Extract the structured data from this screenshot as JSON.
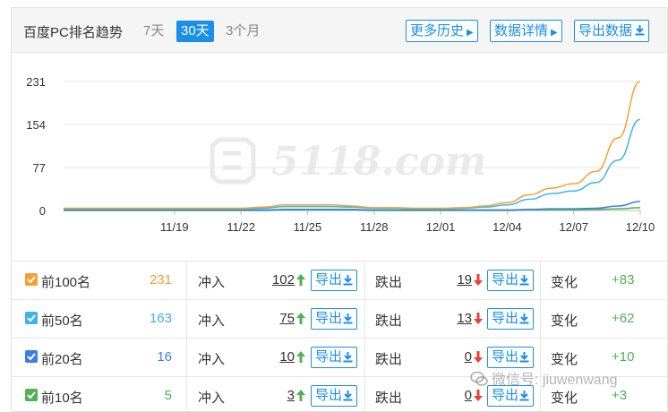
{
  "header": {
    "title": "百度PC排名趋势",
    "tabs": [
      {
        "label": "7天",
        "active": false
      },
      {
        "label": "30天",
        "active": true
      },
      {
        "label": "3个月",
        "active": false
      }
    ],
    "buttons": {
      "history": "更多历史",
      "details": "数据详情",
      "export": "导出数据"
    },
    "accent": "#1a8fe8"
  },
  "chart_data": {
    "type": "line",
    "watermark": "5118.com",
    "y_ticks": [
      "231",
      "154",
      "77",
      "0"
    ],
    "ylim": [
      0,
      231
    ],
    "x_ticks": [
      "11/19",
      "11/22",
      "11/25",
      "11/28",
      "12/01",
      "12/04",
      "12/07",
      "12/10"
    ],
    "x": [
      "11/14",
      "11/15",
      "11/16",
      "11/17",
      "11/18",
      "11/19",
      "11/20",
      "11/21",
      "11/22",
      "11/23",
      "11/24",
      "11/25",
      "11/26",
      "11/27",
      "11/28",
      "11/29",
      "11/30",
      "12/01",
      "12/02",
      "12/03",
      "12/04",
      "12/05",
      "12/06",
      "12/07",
      "12/08",
      "12/09",
      "12/10"
    ],
    "series": [
      {
        "name": "前100名",
        "color": "#f5a032",
        "values": [
          4,
          4,
          4,
          4,
          4,
          4,
          4,
          4,
          4,
          6,
          10,
          10,
          10,
          8,
          5,
          5,
          4,
          4,
          5,
          8,
          14,
          28,
          40,
          48,
          70,
          130,
          231
        ]
      },
      {
        "name": "前50名",
        "color": "#3db5e6",
        "values": [
          3,
          3,
          3,
          3,
          3,
          3,
          3,
          3,
          3,
          4,
          7,
          7,
          7,
          6,
          4,
          4,
          3,
          3,
          4,
          6,
          10,
          20,
          30,
          35,
          50,
          90,
          163
        ]
      },
      {
        "name": "前20名",
        "color": "#3d7ee0",
        "values": [
          1,
          1,
          1,
          1,
          1,
          1,
          1,
          1,
          1,
          1,
          2,
          2,
          2,
          2,
          1,
          1,
          1,
          1,
          1,
          1,
          1,
          2,
          3,
          3,
          4,
          8,
          16
        ]
      },
      {
        "name": "前10名",
        "color": "#52b152",
        "values": [
          0,
          0,
          0,
          0,
          0,
          0,
          0,
          0,
          0,
          0,
          1,
          1,
          1,
          1,
          0,
          0,
          0,
          0,
          0,
          0,
          0,
          1,
          1,
          1,
          2,
          3,
          5
        ]
      }
    ]
  },
  "rows": [
    {
      "label": "前100名",
      "count": "231",
      "count_color": "#f5a032",
      "check_color": "#f5a032",
      "in_label": "冲入",
      "in_value": "102",
      "export_label": "导出",
      "out_label": "跌出",
      "out_value": "19",
      "change_label": "变化",
      "change_value": "+83"
    },
    {
      "label": "前50名",
      "count": "163",
      "count_color": "#3db5e6",
      "check_color": "#3db5e6",
      "in_label": "冲入",
      "in_value": "75",
      "export_label": "导出",
      "out_label": "跌出",
      "out_value": "13",
      "change_label": "变化",
      "change_value": "+62"
    },
    {
      "label": "前20名",
      "count": "16",
      "count_color": "#3d7ee0",
      "check_color": "#3d7ee0",
      "in_label": "冲入",
      "in_value": "10",
      "export_label": "导出",
      "out_label": "跌出",
      "out_value": "0",
      "change_label": "变化",
      "change_value": "+10"
    },
    {
      "label": "前10名",
      "count": "5",
      "count_color": "#52b152",
      "check_color": "#52b152",
      "in_label": "冲入",
      "in_value": "3",
      "export_label": "导出",
      "out_label": "跌出",
      "out_value": "0",
      "change_label": "变化",
      "change_value": "+3"
    }
  ],
  "watermark": "微信号: jiuwenwang"
}
